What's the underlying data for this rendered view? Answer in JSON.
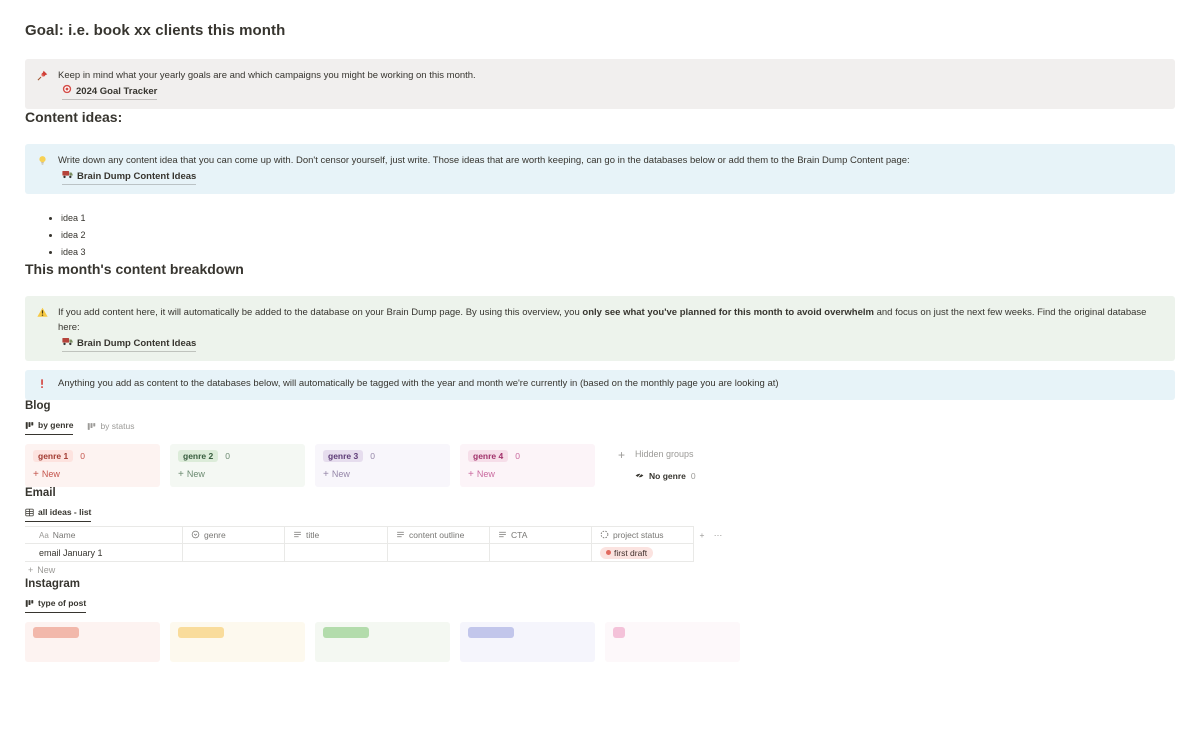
{
  "page_title": "Goal: i.e. book xx clients this month",
  "goal_callout": {
    "icon": "pushpin",
    "text": "Keep in mind what your yearly goals are and which campaigns you might be working on this month.",
    "link": {
      "icon": "dart-target",
      "label": "2024 Goal Tracker"
    }
  },
  "content_ideas": {
    "heading": "Content ideas:",
    "callout": {
      "icon": "lightbulb",
      "text": "Write down any content idea that you can come up with. Don't censor yourself, just write. Those ideas that are worth keeping, can go in the databases below or add them to the Brain Dump Content page:",
      "link": {
        "icon": "truck",
        "label": "Brain Dump Content Ideas"
      }
    },
    "ideas": [
      "idea 1",
      "idea 2",
      "idea 3"
    ]
  },
  "breakdown": {
    "heading": "This month's content breakdown",
    "warning_callout": {
      "icon": "warning",
      "text_before": "If you add content here, it will automatically be added to the database on your Brain Dump page. By using this overview, you ",
      "text_bold": "only see what you've planned for this month to avoid overwhelm",
      "text_after": " and focus on just the next few weeks. Find the original database here:",
      "link": {
        "icon": "truck",
        "label": "Brain Dump Content Ideas"
      }
    },
    "info_callout": {
      "icon": "red-exclamation",
      "text": "Anything you add as content to the databases below, will automatically be tagged with the year and month we're currently in (based on the monthly page you are looking at)"
    }
  },
  "blog": {
    "heading": "Blog",
    "tabs": [
      {
        "label": "by genre",
        "active": true
      },
      {
        "label": "by status",
        "active": false
      }
    ],
    "columns": [
      {
        "name": "genre 1",
        "count": "0",
        "new_label": "New",
        "color": "red"
      },
      {
        "name": "genre 2",
        "count": "0",
        "new_label": "New",
        "color": "green"
      },
      {
        "name": "genre 3",
        "count": "0",
        "new_label": "New",
        "color": "purple"
      },
      {
        "name": "genre 4",
        "count": "0",
        "new_label": "New",
        "color": "pink"
      }
    ],
    "add_group_label": "+",
    "hidden_groups_label": "Hidden groups",
    "hidden_group": {
      "name": "No genre",
      "count": "0"
    }
  },
  "email": {
    "heading": "Email",
    "tab": "all ideas - list",
    "table": {
      "headers": [
        {
          "icon": "text-aa",
          "label": "Name"
        },
        {
          "icon": "select",
          "label": "genre"
        },
        {
          "icon": "text-lines",
          "label": "title"
        },
        {
          "icon": "text-lines",
          "label": "content outline"
        },
        {
          "icon": "text-lines",
          "label": "CTA"
        },
        {
          "icon": "status",
          "label": "project status"
        }
      ],
      "add_column_label": "+",
      "more_label": "⋯",
      "rows": [
        {
          "name": "email January 1",
          "genre": "",
          "title": "",
          "content_outline": "",
          "cta": "",
          "project_status": "first draft"
        }
      ],
      "new_label": "New"
    }
  },
  "instagram": {
    "heading": "Instagram",
    "tab": "type of post"
  },
  "ui_text": {
    "plus": "+"
  },
  "colors": {
    "text": "#37352f",
    "muted_text": "#787774",
    "callout_gray_bg": "#f1efee",
    "callout_blue_bg": "#e7f3f8",
    "callout_green_bg": "#edf3ec",
    "tag_red_bg": "#fde3df",
    "tag_green_bg": "#dcecd9",
    "tag_purple_bg": "#e6ddee",
    "tag_pink_bg": "#f6dee9",
    "status_first_draft_bg": "#fbe3e0",
    "status_first_draft_dot": "#e16a5f"
  }
}
